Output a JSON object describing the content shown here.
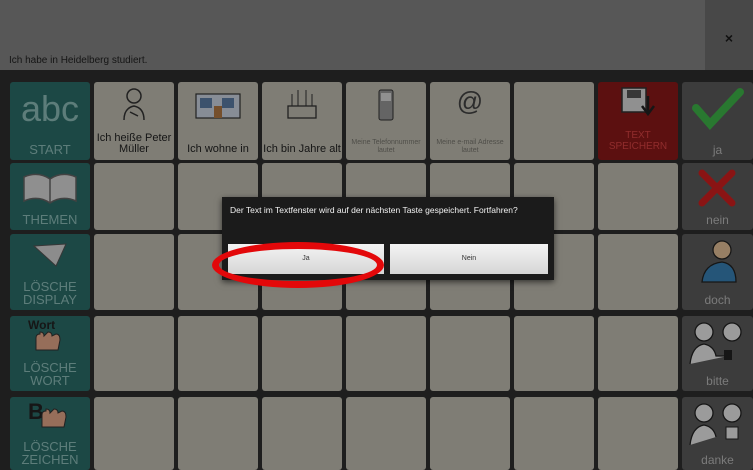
{
  "textbar": {
    "text": "Ich habe in Heidelberg studiert."
  },
  "close": {
    "label": "×"
  },
  "sidebar": {
    "start": {
      "big": "abc",
      "label": "START"
    },
    "themen": {
      "label": "THEMEN"
    },
    "loesche_display": {
      "label": "LÖSCHE DISPLAY"
    },
    "loesche_wort": {
      "top": "Wort",
      "label": "LÖSCHE WORT"
    },
    "loesche_zeichen": {
      "top": "B",
      "label": "LÖSCHE ZEICHEN"
    }
  },
  "row1": {
    "heisse": "Ich heiße Peter Müller",
    "wohne": "Ich wohne in",
    "jahre": "Ich bin Jahre alt",
    "telefon": "Meine Telefonnummer lautet",
    "email": "Meine e-mail Adresse lautet",
    "email_icon": "@",
    "speichern": "TEXT SPEICHERN"
  },
  "right": {
    "ja": "ja",
    "nein": "nein",
    "doch": "doch",
    "bitte": "bitte",
    "danke": "danke"
  },
  "dialog": {
    "message": "Der Text im Textfenster wird auf der nächsten Taste gespeichert. Fortfahren?",
    "yes": "Ja",
    "no": "Nein"
  }
}
